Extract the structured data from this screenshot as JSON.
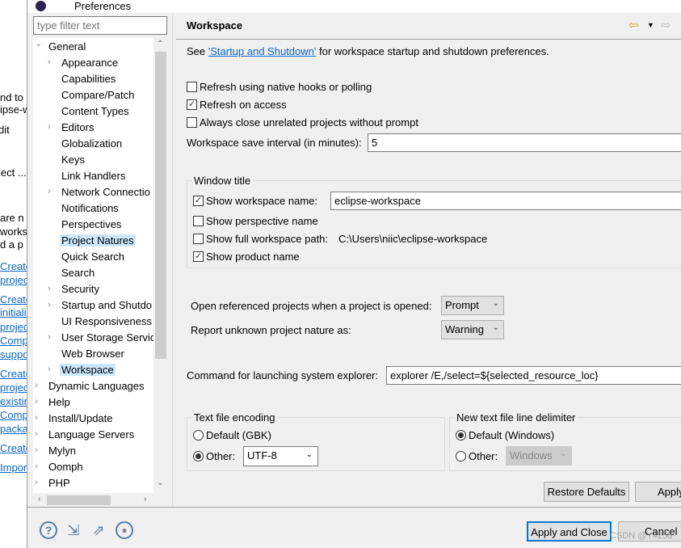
{
  "background_window": {
    "fragments": [
      "nd to",
      "ipse-w",
      "dit",
      "ject ...",
      "are n",
      "worksp",
      "d a p"
    ],
    "links": [
      "Create",
      "projec",
      "Create",
      "initializ",
      "projec",
      "Comp",
      "suppo",
      "Create",
      "projec",
      "existin",
      "Comp",
      "packa",
      "Create",
      "Impor"
    ]
  },
  "dialog": {
    "title": "Preferences"
  },
  "filter": {
    "placeholder": "type filter text"
  },
  "tree": [
    {
      "label": "General",
      "level": 0,
      "expanded": true
    },
    {
      "label": "Appearance",
      "level": 1,
      "expandable": true
    },
    {
      "label": "Capabilities",
      "level": 1
    },
    {
      "label": "Compare/Patch",
      "level": 1
    },
    {
      "label": "Content Types",
      "level": 1
    },
    {
      "label": "Editors",
      "level": 1,
      "expandable": true
    },
    {
      "label": "Globalization",
      "level": 1
    },
    {
      "label": "Keys",
      "level": 1
    },
    {
      "label": "Link Handlers",
      "level": 1
    },
    {
      "label": "Network Connectio",
      "level": 1,
      "expandable": true
    },
    {
      "label": "Notifications",
      "level": 1
    },
    {
      "label": "Perspectives",
      "level": 1
    },
    {
      "label": "Project Natures",
      "level": 1,
      "highlighted": true
    },
    {
      "label": "Quick Search",
      "level": 1
    },
    {
      "label": "Search",
      "level": 1
    },
    {
      "label": "Security",
      "level": 1,
      "expandable": true
    },
    {
      "label": "Startup and Shutdo",
      "level": 1,
      "expandable": true
    },
    {
      "label": "UI Responsiveness",
      "level": 1
    },
    {
      "label": "User Storage Servic",
      "level": 1,
      "expandable": true
    },
    {
      "label": "Web Browser",
      "level": 1
    },
    {
      "label": "Workspace",
      "level": 1,
      "expandable": true,
      "selected": true
    },
    {
      "label": "Dynamic Languages",
      "level": 0,
      "expandable": true
    },
    {
      "label": "Help",
      "level": 0,
      "expandable": true
    },
    {
      "label": "Install/Update",
      "level": 0,
      "expandable": true
    },
    {
      "label": "Language Servers",
      "level": 0,
      "expandable": true
    },
    {
      "label": "Mylyn",
      "level": 0,
      "expandable": true
    },
    {
      "label": "Oomph",
      "level": 0,
      "expandable": true
    },
    {
      "label": "PHP",
      "level": 0,
      "expandable": true
    }
  ],
  "page": {
    "title": "Workspace",
    "intro_before": "See ",
    "intro_link": "'Startup and Shutdown'",
    "intro_after": " for workspace startup and shutdown preferences.",
    "refresh_native": {
      "label": "Refresh using native hooks or polling",
      "checked": false
    },
    "refresh_access": {
      "label": "Refresh on access",
      "checked": true
    },
    "always_close": {
      "label": "Always close unrelated projects without prompt",
      "checked": false
    },
    "save_interval": {
      "label": "Workspace save interval (in minutes):",
      "value": "5"
    },
    "window_title": {
      "legend": "Window title",
      "show_workspace_name": {
        "label": "Show workspace name:",
        "checked": true,
        "value": "eclipse-workspace"
      },
      "show_perspective_name": {
        "label": "Show perspective name",
        "checked": false
      },
      "show_full_path": {
        "label": "Show full workspace path:",
        "checked": false,
        "value": "C:\\Users\\niic\\eclipse-workspace"
      },
      "show_product_name": {
        "label": "Show product name",
        "checked": true
      }
    },
    "open_referenced": {
      "label": "Open referenced projects when a project is opened:",
      "value": "Prompt"
    },
    "report_unknown": {
      "label": "Report unknown project nature as:",
      "value": "Warning"
    },
    "explorer_command": {
      "label": "Command for launching system explorer:",
      "value": "explorer /E,/select=${selected_resource_loc}"
    },
    "encoding": {
      "legend": "Text file encoding",
      "default_label": "Default (GBK)",
      "other_label": "Other:",
      "selected": "other",
      "value": "UTF-8"
    },
    "line_delimiter": {
      "legend": "New text file line delimiter",
      "default_label": "Default (Windows)",
      "other_label": "Other:",
      "selected": "default",
      "value": "Windows"
    },
    "restore_defaults": "Restore Defaults",
    "apply": "Apply"
  },
  "footer": {
    "apply_close": "Apply and Close",
    "cancel": "Cancel"
  },
  "watermark": "CSDN @Y4258"
}
